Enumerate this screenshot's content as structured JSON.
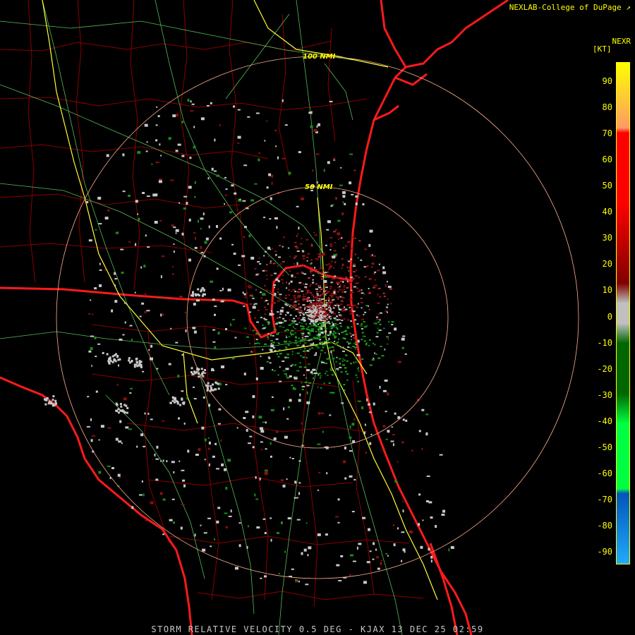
{
  "header": {
    "credit": "NEXLAB-College of DuPage",
    "product_code": "NEXR",
    "units_label": "[KT]"
  },
  "legend": {
    "ticks": [
      "90",
      "80",
      "70",
      "60",
      "50",
      "40",
      "30",
      "20",
      "10",
      "0",
      "-10",
      "-20",
      "-30",
      "-40",
      "-50",
      "-60",
      "-70",
      "-80",
      "-90"
    ],
    "range_kt": [
      -95,
      95
    ],
    "colors": {
      "top": "#ffff00",
      "orange": "#ff9966",
      "red": "#ff0000",
      "dark_red": "#800000",
      "gray": "#c0c0c0",
      "dark_green": "#006600",
      "green": "#00ff44",
      "blue": "#0055bb",
      "light_blue": "#22aaff"
    }
  },
  "range_rings": [
    {
      "label": "100 NMI",
      "nmi": 100
    },
    {
      "label": "50 NMI",
      "nmi": 50
    }
  ],
  "map_colors": {
    "coastline": "#ff1a1a",
    "county_lines": "#8b0000",
    "highways": "#ffff33",
    "roads": "#66dd66",
    "rings": "#ffb090"
  },
  "status_bar": {
    "text": "STORM RELATIVE VELOCITY 0.5 DEG - KJAX 13 DEC 25 02:59"
  }
}
